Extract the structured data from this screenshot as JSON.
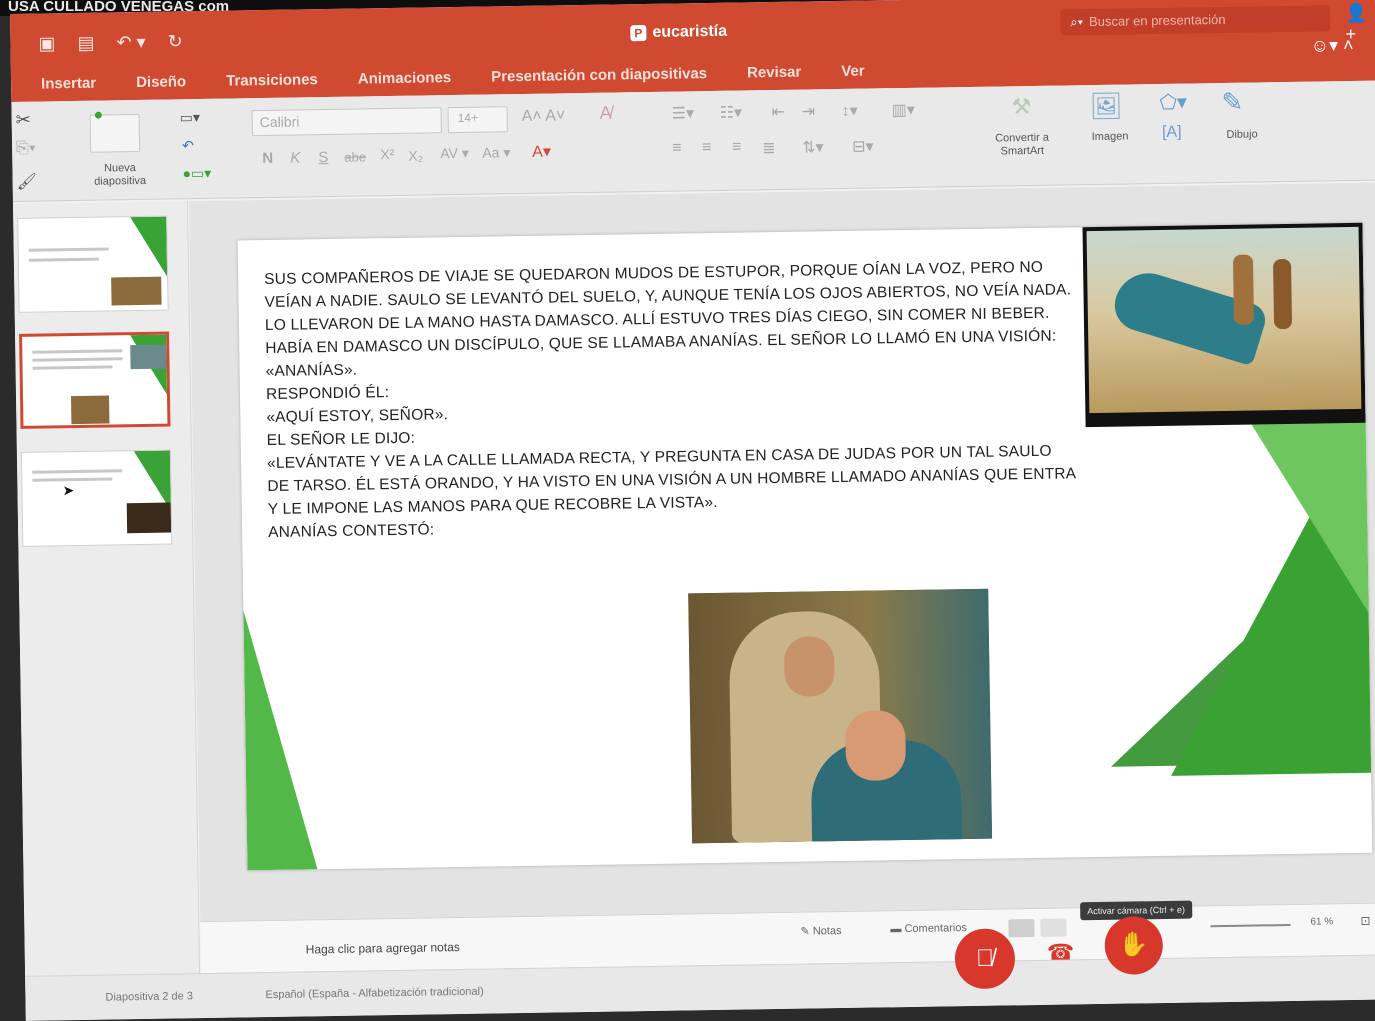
{
  "top_caption": "USA CULLADO VENEGAS com",
  "window": {
    "title": "eucaristía",
    "search_placeholder": "Buscar en presentación"
  },
  "tabs": [
    "Insertar",
    "Diseño",
    "Transiciones",
    "Animaciones",
    "Presentación con diapositivas",
    "Revisar",
    "Ver"
  ],
  "ribbon": {
    "new_slide_label": "Nueva diapositiva",
    "font_name": "Calibri",
    "font_size": "14+",
    "bold": "N",
    "italic": "K",
    "underline": "S",
    "strike": "abe",
    "convert_smartart": "Convertir a SmartArt",
    "image_label": "Imagen",
    "draw_label": "Dibujo"
  },
  "slide": {
    "text": "SUS COMPAÑEROS DE VIAJE SE QUEDARON MUDOS DE ESTUPOR, PORQUE OÍAN LA VOZ, PERO NO VEÍAN A NADIE. SAULO SE LEVANTÓ DEL SUELO, Y, AUNQUE TENÍA LOS OJOS ABIERTOS, NO VEÍA NADA. LO LLEVARON DE LA MANO HASTA DAMASCO. ALLÍ ESTUVO TRES DÍAS CIEGO, SIN COMER NI BEBER.",
    "lines": [
      "HABÍA EN DAMASCO UN DISCÍPULO, QUE SE LLAMABA ANANÍAS. EL SEÑOR LO LLAMÓ EN UNA VISIÓN:",
      "«ANANÍAS».",
      "RESPONDIÓ ÉL:",
      "«AQUÍ ESTOY, SEÑOR».",
      "EL SEÑOR LE DIJO:",
      "«LEVÁNTATE Y VE A LA CALLE LLAMADA RECTA, Y PREGUNTA EN CASA DE JUDAS POR UN TAL SAULO DE TARSO. ÉL ESTÁ ORANDO, Y HA VISTO EN UNA VISIÓN A UN HOMBRE LLAMADO ANANÍAS QUE ENTRA Y LE IMPONE LAS MANOS PARA QUE RECOBRE LA VISTA».",
      "ANANÍAS CONTESTÓ:"
    ]
  },
  "notes": {
    "placeholder": "Haga clic para agregar notas",
    "notes_btn": "Notas",
    "comments_btn": "Comentarios",
    "tooltip": "Activar cámara (Ctrl + e)",
    "zoom": "61 %"
  },
  "status": {
    "slide_count": "Diapositiva 2 de 3",
    "language": "Español (España - Alfabetización tradicional)"
  },
  "colors": {
    "accent": "#d04a32",
    "green": "#3aa233"
  }
}
